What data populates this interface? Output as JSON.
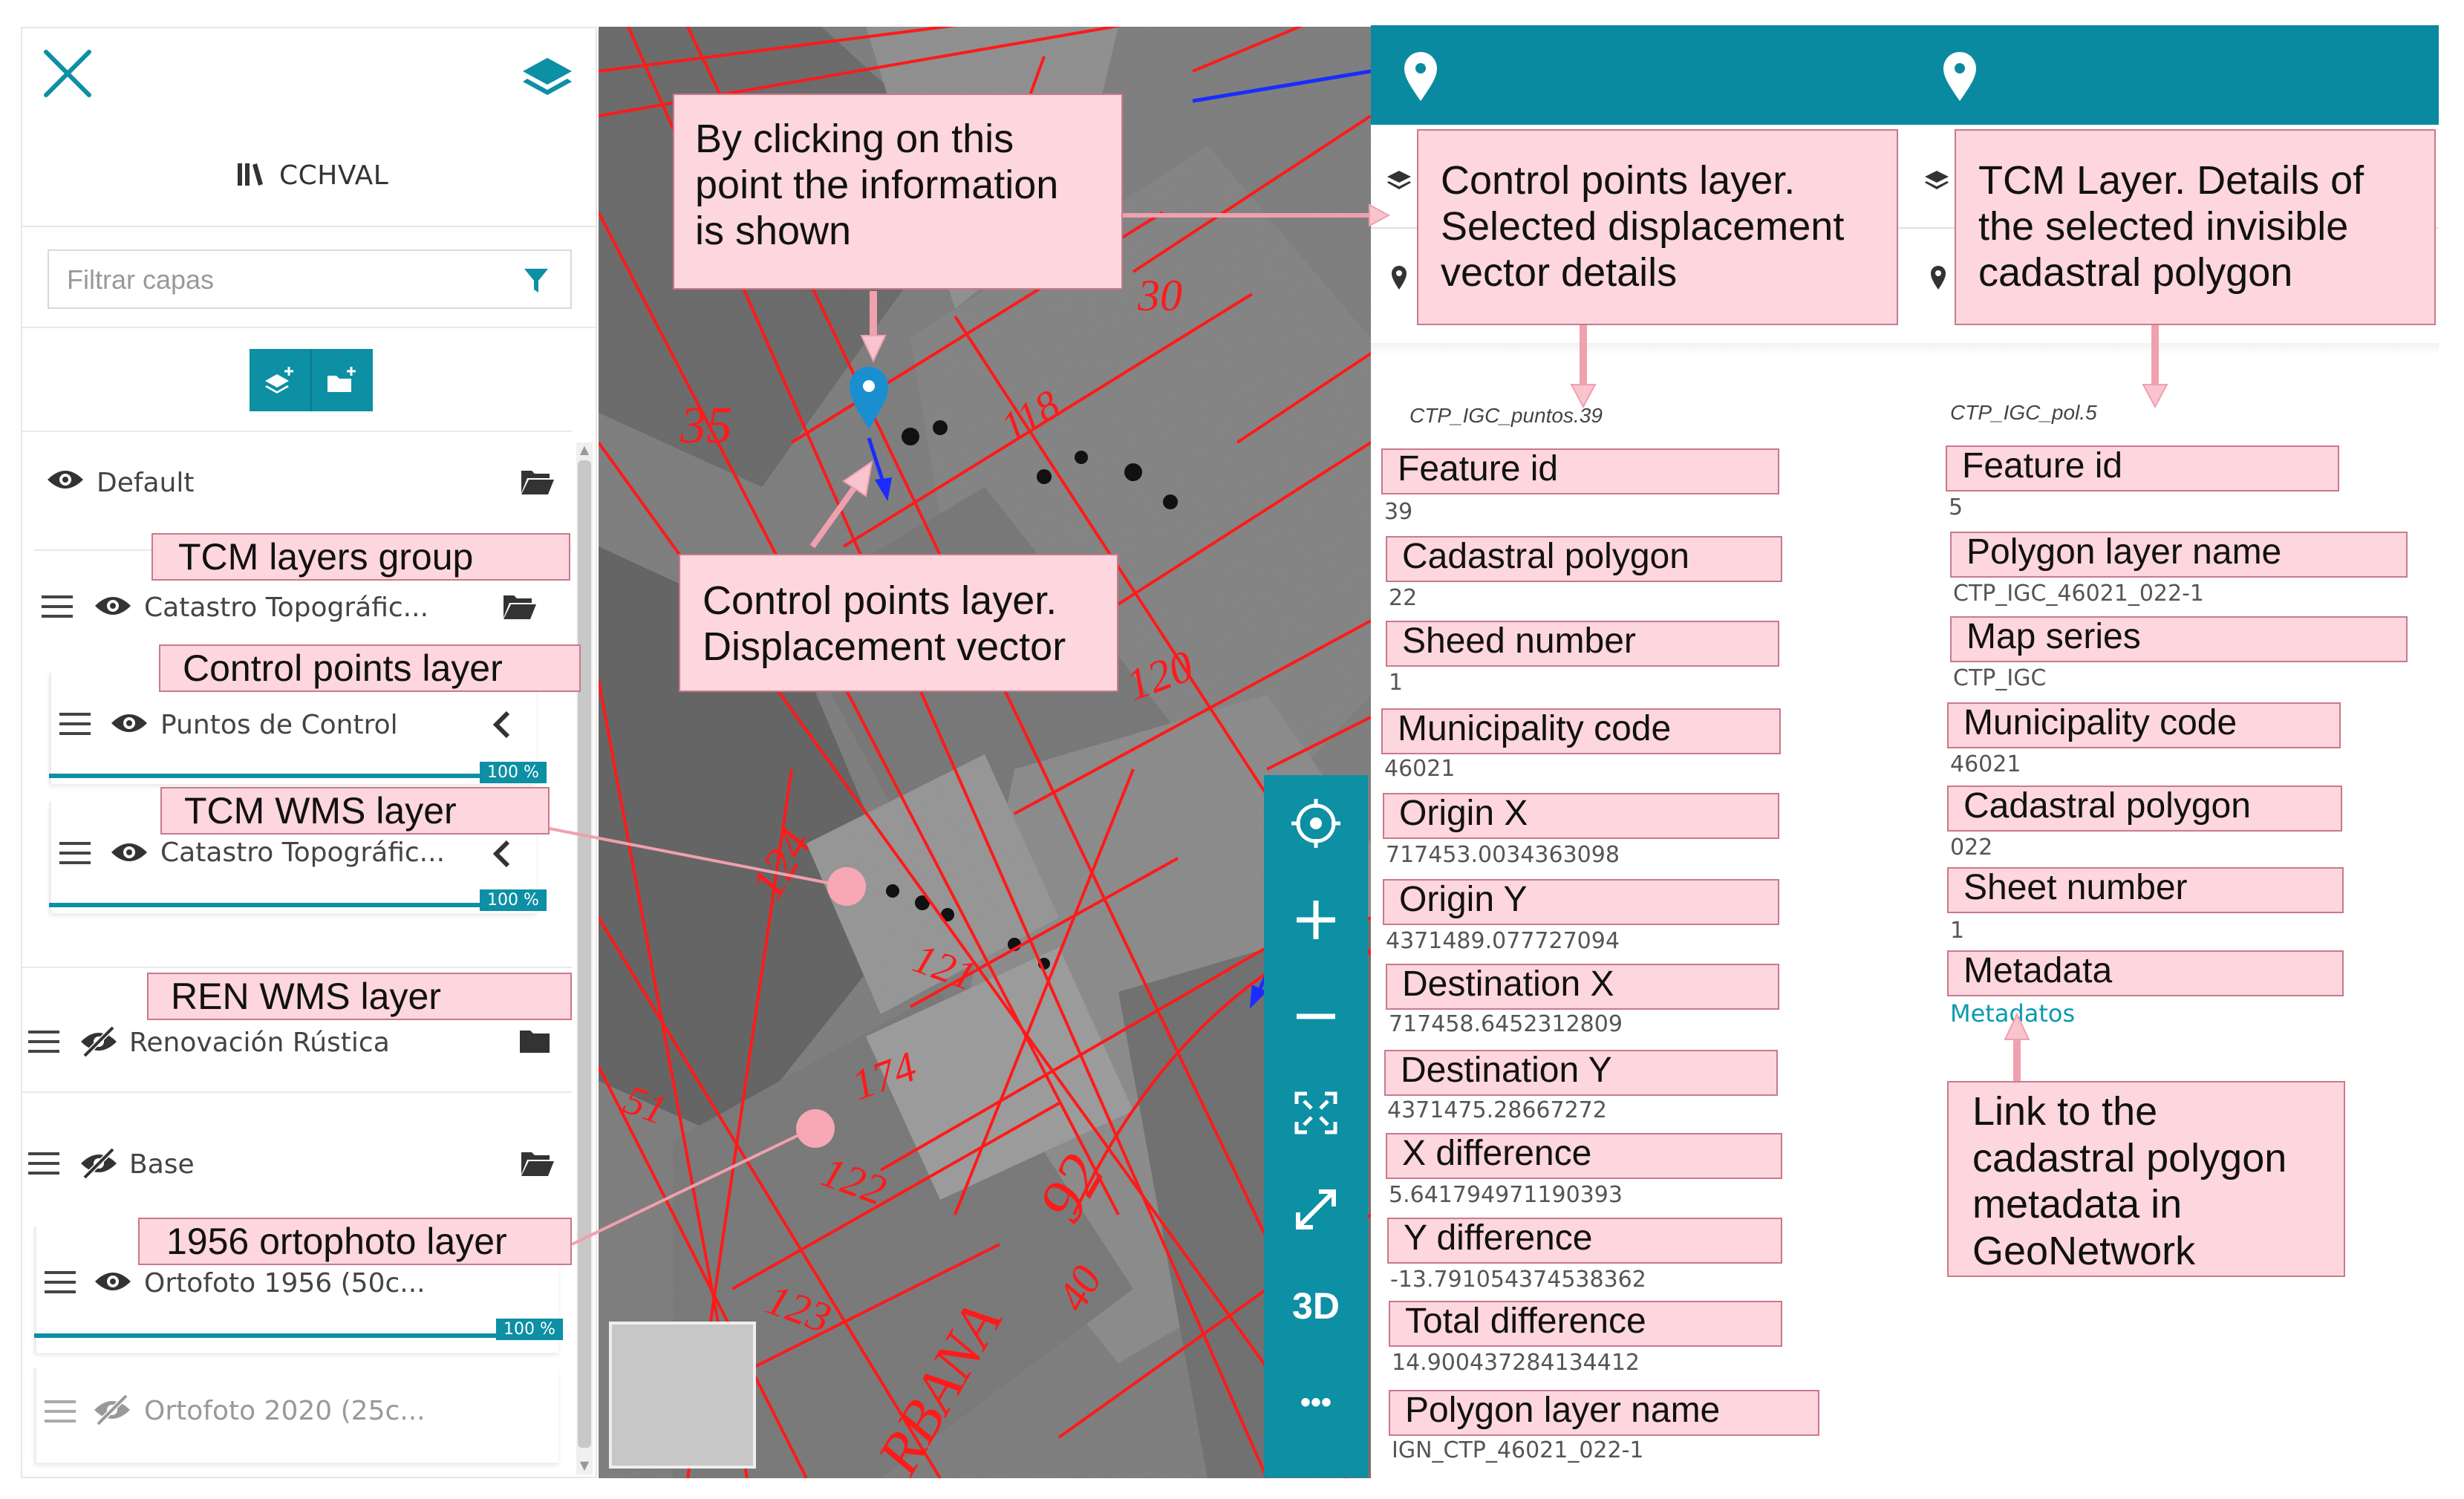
{
  "left_panel": {
    "app_name": "CCHVAL",
    "filter_placeholder": "Filtrar capas",
    "layers": [
      {
        "name": "Default",
        "visible": true
      },
      {
        "name": "Catastro Topográfic...",
        "visible": true
      },
      {
        "name": "Puntos de Control",
        "visible": true,
        "opacity_label": "100 %"
      },
      {
        "name": "Catastro Topográfic...",
        "visible": true,
        "opacity_label": "100 %"
      },
      {
        "name": "Renovación Rústica",
        "visible": false
      },
      {
        "name": "Base",
        "visible": false
      },
      {
        "name": "Ortofoto 1956 (50c...",
        "visible": true,
        "opacity_label": "100 %"
      },
      {
        "name": "Ortofoto 2020 (25c...",
        "visible": false
      }
    ]
  },
  "annotations": {
    "tcm_group": "TCM layers group",
    "control_points_layer": "Control points layer",
    "tcm_wms": "TCM WMS layer",
    "ren_wms": "REN WMS layer",
    "ortho_1956": "1956 ortophoto layer",
    "click_info_lines": [
      "By clicking on this",
      "point the information",
      "is shown"
    ],
    "displacement_lines": [
      "Control points layer.",
      "Displacement vector"
    ],
    "cp_details_lines": [
      "Control points layer.",
      "Selected displacement",
      "vector details"
    ],
    "tcm_details_lines": [
      "TCM Layer. Details of",
      "the selected invisible",
      "cadastral polygon"
    ],
    "metadata_link_lines": [
      "Link to the",
      "cadastral polygon",
      "metadata in",
      "GeoNetwork"
    ]
  },
  "map": {
    "parcel_numbers": [
      "35",
      "30",
      "118",
      "120",
      "124",
      "121",
      "174",
      "122",
      "123",
      "40",
      "RBANA",
      "92",
      "51"
    ],
    "toolbar_3d": "3D",
    "toolbar_more": "•••"
  },
  "control_points_info": {
    "feature_id": "CTP_IGC_puntos.39",
    "fields": [
      {
        "label": "Feature id",
        "value": "39"
      },
      {
        "label": "Cadastral polygon",
        "value": "22"
      },
      {
        "label": "Sheed number",
        "value": "1"
      },
      {
        "label": "Municipality code",
        "value": "46021"
      },
      {
        "label": "Origin X",
        "value": "717453.0034363098"
      },
      {
        "label": "Origin Y",
        "value": "4371489.077727094"
      },
      {
        "label": "Destination X",
        "value": "717458.6452312809"
      },
      {
        "label": "Destination Y",
        "value": "4371475.28667272"
      },
      {
        "label": "X difference",
        "value": "5.641794971190393"
      },
      {
        "label": "Y difference",
        "value": "-13.791054374538362"
      },
      {
        "label": "Total difference",
        "value": "14.900437284134412"
      },
      {
        "label": "Polygon layer name",
        "value": "IGN_CTP_46021_022-1"
      }
    ]
  },
  "tcm_info": {
    "feature_id": "CTP_IGC_pol.5",
    "fields": [
      {
        "label": "Feature id",
        "value": "5"
      },
      {
        "label": "Polygon layer name",
        "value": "CTP_IGC_46021_022-1"
      },
      {
        "label": "Map series",
        "value": "CTP_IGC"
      },
      {
        "label": "Municipality code",
        "value": "46021"
      },
      {
        "label": "Cadastral polygon",
        "value": "022"
      },
      {
        "label": "Sheet  number",
        "value": "1"
      },
      {
        "label": "Metadata",
        "value": "Metadatos"
      }
    ]
  },
  "colors": {
    "accent": "#0d8fa4",
    "annotation_fill": "#fdd6de",
    "annotation_border": "#c97a8b",
    "cadastral_lines": "#ff1a1a",
    "link": "#0a9ab0"
  }
}
